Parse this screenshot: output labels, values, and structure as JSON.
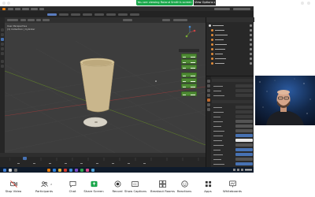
{
  "share_banner": {
    "status_text": "You are viewing Roland Smith's screen",
    "view_options_label": "View Options",
    "colors": {
      "share_green": "#19a74a",
      "options_bg": "#2d2d2d"
    }
  },
  "blender": {
    "viewport_info": {
      "line1": "User Perspective",
      "line2": "(1) Collection | Cylinder"
    },
    "active_tool_icon": "move-tool-icon",
    "object": {
      "name": "Cylinder",
      "icon": "cup-icon",
      "base_icon": "disc-icon"
    },
    "outliner_rows": 9,
    "properties_rows": 17,
    "timeline_frame": "1",
    "colors": {
      "viewport_bg": "#3d3d3d",
      "x_axis": "#8c3b3b",
      "y_axis": "#5d7a2c",
      "cup_body": "#c9b68c",
      "selection": "#4e8a34",
      "active": "#4772b3"
    }
  },
  "participant": {
    "icon": "webcam-person-icon",
    "background": "starry-space"
  },
  "zoom_bar": {
    "buttons": [
      {
        "id": "stop-video",
        "label": "Stop Video",
        "icon": "video-camera-icon"
      },
      {
        "id": "participants",
        "label": "Participants",
        "icon": "people-icon",
        "count": "2"
      },
      {
        "id": "chat",
        "label": "Chat",
        "icon": "chat-bubble-icon"
      },
      {
        "id": "share-screen",
        "label": "Share Screen",
        "icon": "share-screen-icon"
      },
      {
        "id": "record",
        "label": "Record",
        "icon": "record-icon"
      },
      {
        "id": "show-captions",
        "label": "Show Captions",
        "icon": "cc-icon"
      },
      {
        "id": "breakout-rooms",
        "label": "Breakout Rooms",
        "icon": "breakout-icon"
      },
      {
        "id": "reactions",
        "label": "Reactions",
        "icon": "smiley-icon"
      },
      {
        "id": "apps",
        "label": "Apps",
        "icon": "apps-icon"
      },
      {
        "id": "whiteboards",
        "label": "Whiteboards",
        "icon": "whiteboard-icon"
      }
    ]
  }
}
